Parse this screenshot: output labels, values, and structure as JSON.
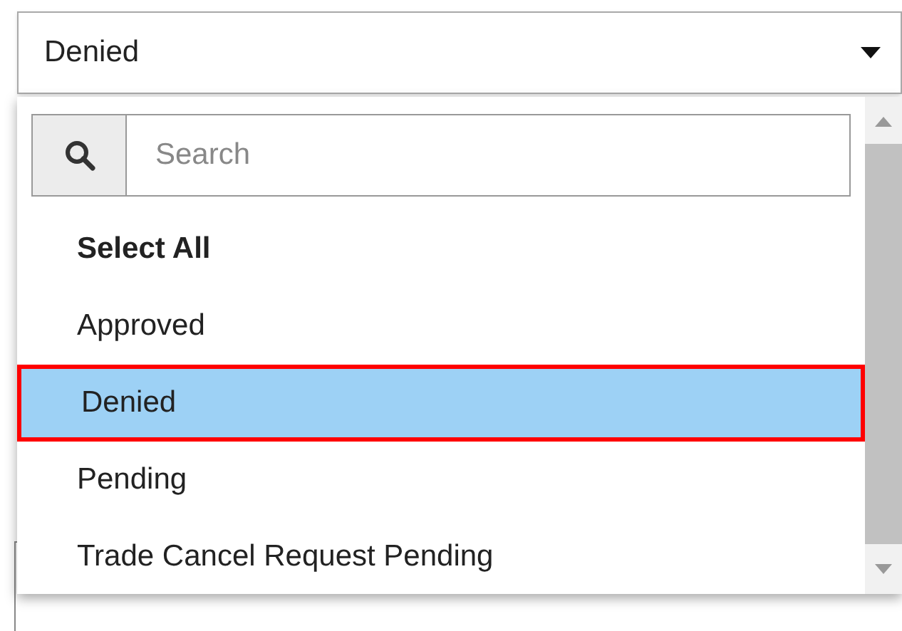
{
  "select": {
    "value": "Denied",
    "expanded": true
  },
  "search": {
    "placeholder": "Search"
  },
  "options": [
    {
      "label": "Select All",
      "kind": "all",
      "selected": false
    },
    {
      "label": "Approved",
      "kind": "option",
      "selected": false
    },
    {
      "label": "Denied",
      "kind": "option",
      "selected": true
    },
    {
      "label": "Pending",
      "kind": "option",
      "selected": false
    },
    {
      "label": "Trade Cancel Request Pending",
      "kind": "option",
      "selected": false
    }
  ]
}
